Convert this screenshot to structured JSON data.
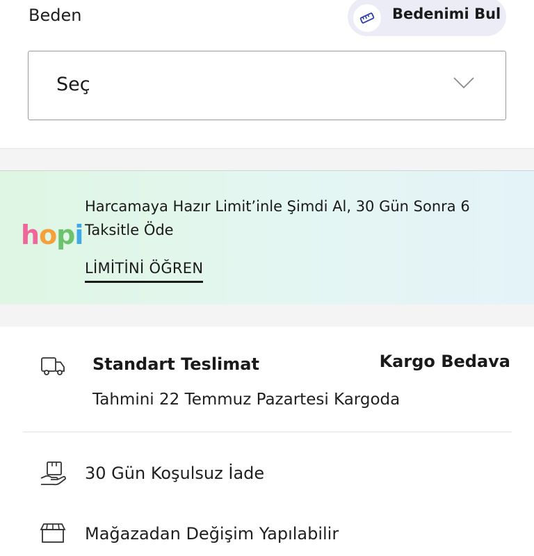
{
  "size": {
    "title": "Beden",
    "find_size_label": "Bedenimi Bul",
    "find_size_icon": "ruler-icon",
    "select_value": "Seç",
    "select_icon": "chevron-down-icon"
  },
  "hopi": {
    "logo": [
      "h",
      "o",
      "p",
      "i"
    ],
    "logo_colors": [
      "#f0659a",
      "#f4a13b",
      "#6cc26f",
      "#3fa8e6"
    ],
    "text": "Harcamaya Hazır Limit’inle Şimdi Al, 30 Gün Sonra 6 Taksitle Öde",
    "link": "LİMİTİNİ ÖĞREN"
  },
  "shipping": {
    "icon": "truck-icon",
    "title": "Standart Teslimat",
    "badge": "Kargo Bedava",
    "estimate": "Tahmini 22 Temmuz Pazartesi Kargoda"
  },
  "features": [
    {
      "icon": "return-box-icon",
      "label": "30 Gün Koşulsuz İade"
    },
    {
      "icon": "store-icon",
      "label": "Mağazadan Değişim Yapılabilir"
    }
  ]
}
